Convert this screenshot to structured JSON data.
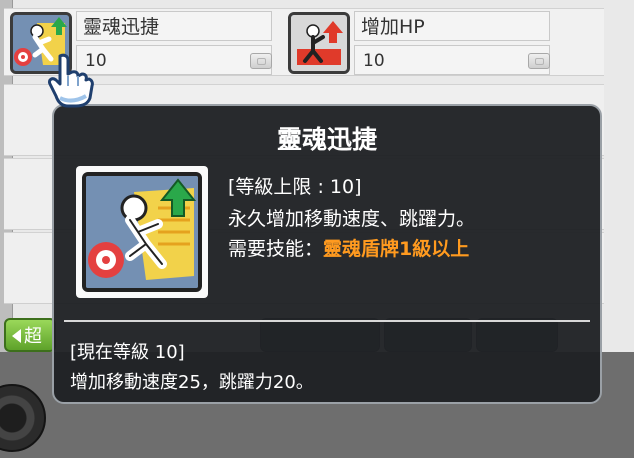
{
  "skill_list": {
    "items": [
      {
        "name": "靈魂迅捷",
        "level": "10",
        "icon": "soul-swiftness-icon"
      },
      {
        "name": "增加HP",
        "level": "10",
        "icon": "increase-hp-icon"
      }
    ],
    "buttons": {
      "green_label": "超",
      "gray_1_label": "",
      "gray_2_label": "",
      "gray_3_label": ""
    }
  },
  "tooltip": {
    "title": "靈魂迅捷",
    "icon": "soul-swiftness-icon",
    "max_level_line": "[等級上限 : 10]",
    "description": "永久增加移動速度、跳躍力。",
    "required_skill_label": "需要技能：",
    "required_skill_value": "靈魂盾牌1級以上",
    "current_level_label": "[現在等級 10]",
    "current_effect": "增加移動速度25，跳躍力20。"
  },
  "colors": {
    "tooltip_background": "#1f2124",
    "requirement_accent": "#ff9a1f",
    "text_primary": "#ffffff"
  }
}
